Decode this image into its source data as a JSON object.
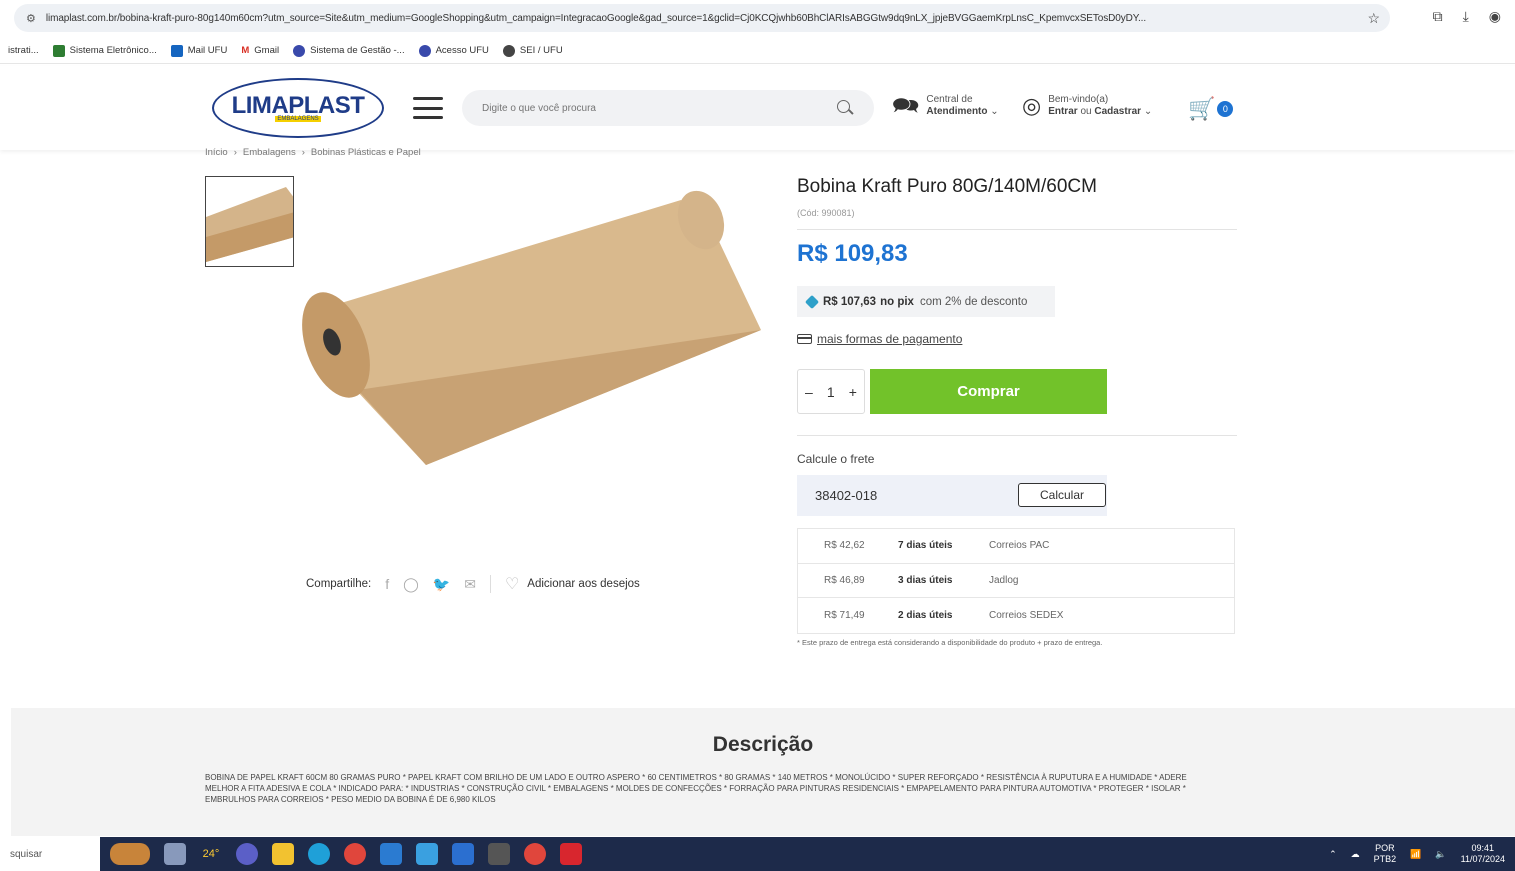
{
  "browser": {
    "url": "limaplast.com.br/bobina-kraft-puro-80g140m60cm?utm_source=Site&utm_medium=GoogleShopping&utm_campaign=IntegracaoGoogle&gad_source=1&gclid=Cj0KCQjwhb60BhClARIsABGGtw9dq9nLX_jpjeBVGGaemKrpLnsC_KpemvcxSETosD0yDY...",
    "bookmarks": [
      {
        "label": "istrati...",
        "color": ""
      },
      {
        "label": "Sistema Eletrônico...",
        "color": "#2e7d32"
      },
      {
        "label": "Mail UFU",
        "color": "#1565c0"
      },
      {
        "label": "Gmail",
        "color": "#d93025"
      },
      {
        "label": "Sistema de Gestão -...",
        "color": "#3949ab"
      },
      {
        "label": "Acesso UFU",
        "color": "#3949ab"
      },
      {
        "label": "SEI / UFU",
        "color": "#444444"
      }
    ]
  },
  "header": {
    "logo_text": "LIMAPLAST",
    "logo_sub": "EMBALAGENS",
    "search_placeholder": "Digite o que você procura",
    "atendimento_line1": "Central de",
    "atendimento_line2": "Atendimento",
    "welcome_line1": "Bem-vindo(a)",
    "welcome_entrar": "Entrar",
    "welcome_ou": "ou",
    "welcome_cadastrar": "Cadastrar",
    "cart_count": "0"
  },
  "breadcrumb": [
    "Início",
    "Embalagens",
    "Bobinas Plásticas e Papel"
  ],
  "product": {
    "title": "Bobina Kraft Puro 80G/140M/60CM",
    "code": "(Cód: 990081)",
    "price": "R$ 109,83",
    "pix_price": "R$ 107,63",
    "pix_label": "no pix",
    "pix_discount": "com 2% de desconto",
    "more_payment": "mais formas de pagamento",
    "quantity": "1",
    "buy_label": "Comprar"
  },
  "share": {
    "label": "Compartilhe:",
    "wishlist": "Adicionar aos desejos"
  },
  "shipping": {
    "label": "Calcule o frete",
    "cep": "38402-018",
    "calc_label": "Calcular",
    "options": [
      {
        "price": "R$ 42,62",
        "days": "7 dias úteis",
        "carrier": "Correios PAC"
      },
      {
        "price": "R$ 46,89",
        "days": "3 dias úteis",
        "carrier": "Jadlog"
      },
      {
        "price": "R$ 71,49",
        "days": "2 dias úteis",
        "carrier": "Correios SEDEX"
      }
    ],
    "note": "* Este prazo de entrega está considerando a disponibilidade do produto + prazo de entrega."
  },
  "description": {
    "title": "Descrição",
    "text": "BOBINA DE PAPEL KRAFT 60CM 80 GRAMAS PURO * PAPEL KRAFT COM BRILHO DE UM LADO E OUTRO ASPERO * 60 CENTIMETROS * 80 GRAMAS * 140 METROS * MONOLÚCIDO * SUPER REFORÇADO * RESISTÊNCIA À RUPUTURA E A HUMIDADE * ADERE MELHOR A FITA ADESIVA E COLA * INDICADO PARA: * INDUSTRIAS * CONSTRUÇÃO CIVIL * EMBALAGENS * MOLDES DE CONFECÇÕES * FORRAÇÃO PARA PINTURAS RESIDENCIAIS * EMPAPELAMENTO PARA PINTURA AUTOMOTIVA * PROTEGER * ISOLAR * EMBRULHOS PARA CORREIOS * PESO MEDIO DA BOBINA É DE 6,980 KILOS"
  },
  "taskbar": {
    "search": "squisar",
    "weather": "24°",
    "lang1": "POR",
    "lang2": "PTB2",
    "time": "09:41",
    "date": "11/07/2024"
  },
  "colors": {
    "brand_blue": "#1e73d2",
    "buy_green": "#72c22a",
    "logo_blue": "#1f3c88",
    "kraft": "#c9a67a"
  }
}
